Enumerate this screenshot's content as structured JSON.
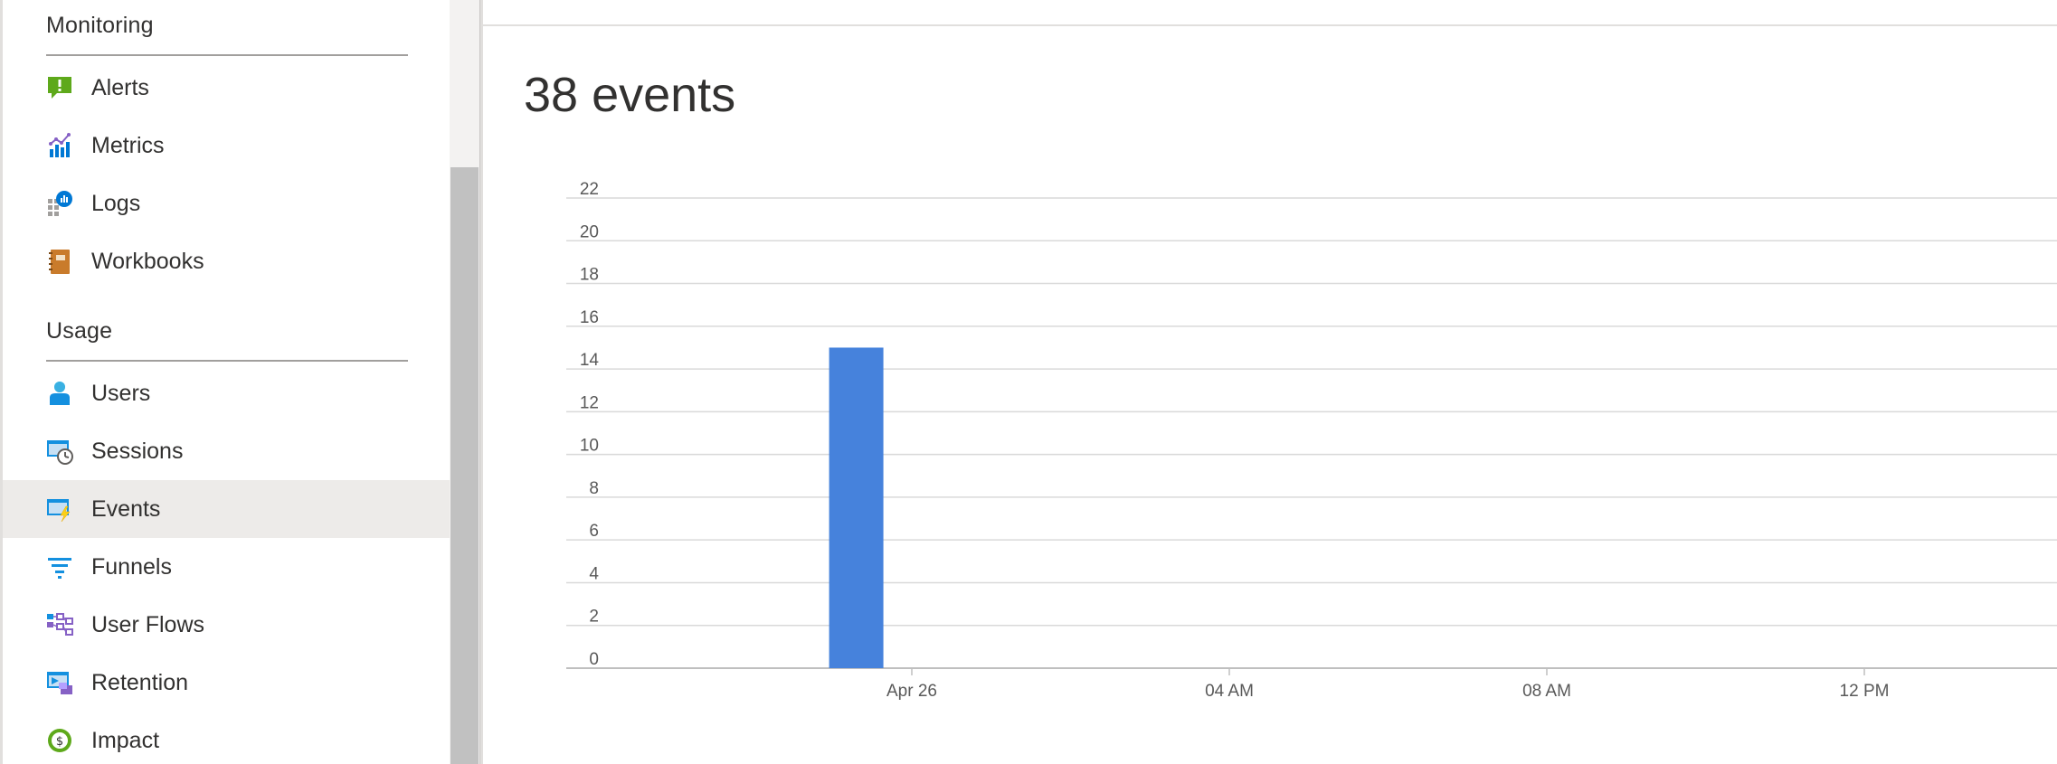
{
  "sidebar": {
    "sections": [
      {
        "title": "Monitoring",
        "items": [
          {
            "label": "Alerts",
            "icon": "alerts-icon"
          },
          {
            "label": "Metrics",
            "icon": "metrics-icon"
          },
          {
            "label": "Logs",
            "icon": "logs-icon"
          },
          {
            "label": "Workbooks",
            "icon": "workbooks-icon"
          }
        ]
      },
      {
        "title": "Usage",
        "items": [
          {
            "label": "Users",
            "icon": "users-icon"
          },
          {
            "label": "Sessions",
            "icon": "sessions-icon"
          },
          {
            "label": "Events",
            "icon": "events-icon",
            "selected": true
          },
          {
            "label": "Funnels",
            "icon": "funnels-icon"
          },
          {
            "label": "User Flows",
            "icon": "user-flows-icon"
          },
          {
            "label": "Retention",
            "icon": "retention-icon"
          },
          {
            "label": "Impact",
            "icon": "impact-icon"
          }
        ]
      }
    ]
  },
  "main": {
    "title": "38 events"
  },
  "colors": {
    "bar": "#4682dc",
    "grid": "#d9d9d9",
    "selected_bg": "#edebe9"
  },
  "chart_data": {
    "type": "bar",
    "title": "",
    "xlabel": "",
    "ylabel": "",
    "ylim": [
      0,
      22
    ],
    "yticks": [
      0,
      2,
      4,
      6,
      8,
      10,
      12,
      14,
      16,
      18,
      20,
      22
    ],
    "xticks": [
      "Apr 26",
      "04 AM",
      "08 AM",
      "12 PM"
    ],
    "bars": [
      {
        "x": "Apr 25 ~11:00 PM",
        "value": 15
      }
    ],
    "grid": true,
    "legend": "none"
  }
}
